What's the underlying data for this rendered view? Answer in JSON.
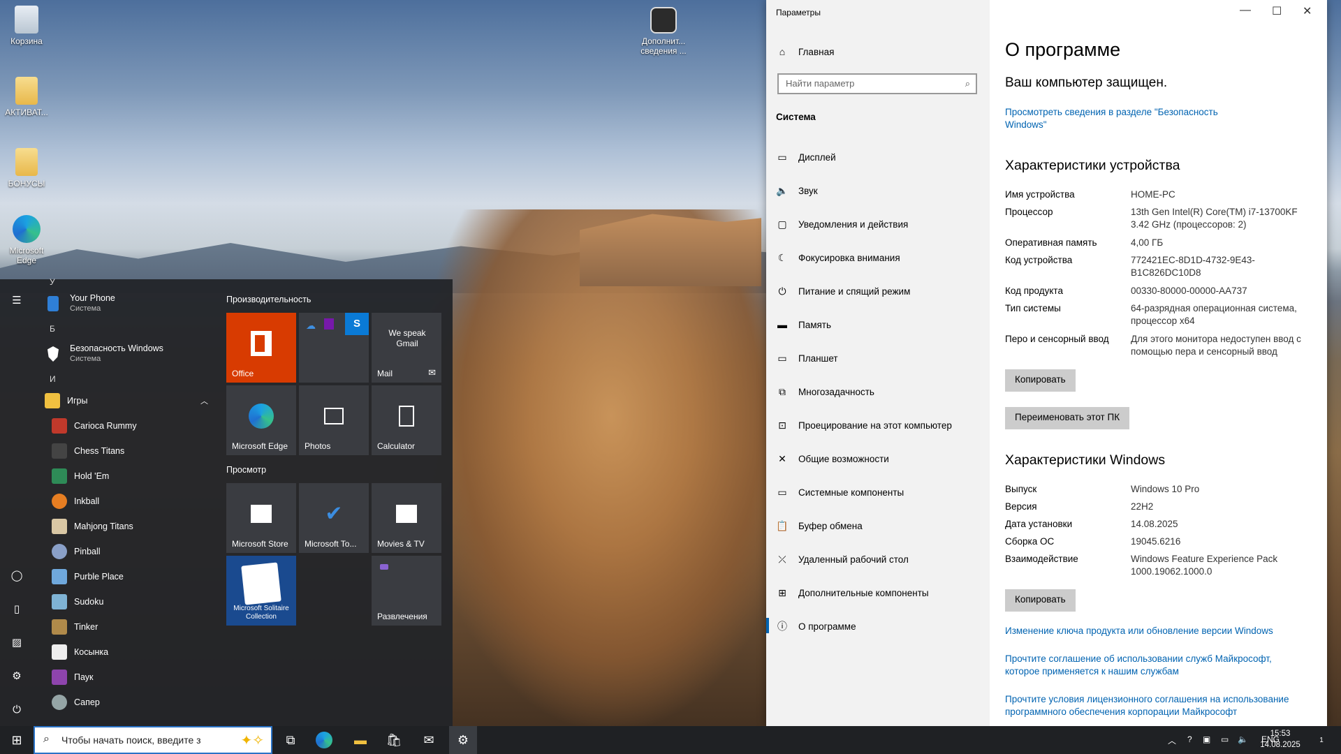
{
  "desktop": {
    "icons": [
      {
        "label": "Корзина",
        "icon": "recycle-bin-icon"
      },
      {
        "label": "АКТИВАТ...",
        "icon": "folder-icon"
      },
      {
        "label": "БОНУСЫ",
        "icon": "folder-icon"
      },
      {
        "label": "Microsoft Edge",
        "icon": "edge-icon"
      },
      {
        "label": "Дополнит... сведения ...",
        "icon": "settings-shortcut-icon"
      }
    ]
  },
  "start_menu": {
    "letters": {
      "top": "У",
      "b": "Б",
      "i": "И"
    },
    "apps": {
      "your_phone": {
        "name": "Your Phone",
        "sub": "Система"
      },
      "security": {
        "name": "Безопасность Windows",
        "sub": "Система"
      },
      "games": {
        "name": "Игры"
      },
      "list": [
        "Carioca Rummy",
        "Chess Titans",
        "Hold 'Em",
        "Inkball",
        "Mahjong Titans",
        "Pinball",
        "Purble Place",
        "Sudoku",
        "Tinker",
        "Косынка",
        "Паук",
        "Сапер"
      ]
    },
    "groups": {
      "productivity": "Производительность",
      "browse": "Просмотр"
    },
    "tiles": {
      "office": "Office",
      "mail": "Mail",
      "mail_text": "We speak Gmail",
      "edge": "Microsoft Edge",
      "photos": "Photos",
      "calculator": "Calculator",
      "store": "Microsoft Store",
      "todo": "Microsoft To...",
      "movies": "Movies & TV",
      "solitaire": "Microsoft Solitaire Collection",
      "entertainment": "Развлечения"
    }
  },
  "settings": {
    "window_title": "Параметры",
    "home": "Главная",
    "search_placeholder": "Найти параметр",
    "section": "Система",
    "nav": [
      "Дисплей",
      "Звук",
      "Уведомления и действия",
      "Фокусировка внимания",
      "Питание и спящий режим",
      "Память",
      "Планшет",
      "Многозадачность",
      "Проецирование на этот компьютер",
      "Общие возможности",
      "Системные компоненты",
      "Буфер обмена",
      "Удаленный рабочий стол",
      "Дополнительные компоненты",
      "О программе"
    ],
    "content": {
      "title": "О программе",
      "protected": "Ваш компьютер защищен.",
      "security_link": "Просмотреть сведения в разделе \"Безопасность Windows\"",
      "device_header": "Характеристики устройства",
      "device": {
        "name_k": "Имя устройства",
        "name_v": "HOME-PC",
        "cpu_k": "Процессор",
        "cpu_v": "13th Gen Intel(R) Core(TM) i7-13700KF 3.42 GHz (процессоров: 2)",
        "ram_k": "Оперативная память",
        "ram_v": "4,00 ГБ",
        "devid_k": "Код устройства",
        "devid_v": "772421EC-8D1D-4732-9E43-B1C826DC10D8",
        "prodid_k": "Код продукта",
        "prodid_v": "00330-80000-00000-AA737",
        "systype_k": "Тип системы",
        "systype_v": "64-разрядная операционная система, процессор x64",
        "pen_k": "Перо и сенсорный ввод",
        "pen_v": "Для этого монитора недоступен ввод с помощью пера и сенсорный ввод"
      },
      "copy_btn": "Копировать",
      "rename_btn": "Переименовать этот ПК",
      "windows_header": "Характеристики Windows",
      "windows": {
        "edition_k": "Выпуск",
        "edition_v": "Windows 10 Pro",
        "version_k": "Версия",
        "version_v": "22H2",
        "installed_k": "Дата установки",
        "installed_v": "14.08.2025",
        "build_k": "Сборка ОС",
        "build_v": "19045.6216",
        "experience_k": "Взаимодействие",
        "experience_v": "Windows Feature Experience Pack 1000.19062.1000.0"
      },
      "copy_btn2": "Копировать",
      "link_key": "Изменение ключа продукта или обновление версии Windows",
      "link_services": "Прочтите соглашение об использовании служб Майкрософт, которое применяется к нашим службам",
      "link_license": "Прочтите условия лицензионного соглашения на использование программного обеспечения корпорации Майкрософт"
    }
  },
  "taskbar": {
    "search_placeholder": "Чтобы начать поиск, введите з",
    "lang": "ENG",
    "time": "15:53",
    "date": "14.08.2025",
    "notifications": "1"
  }
}
